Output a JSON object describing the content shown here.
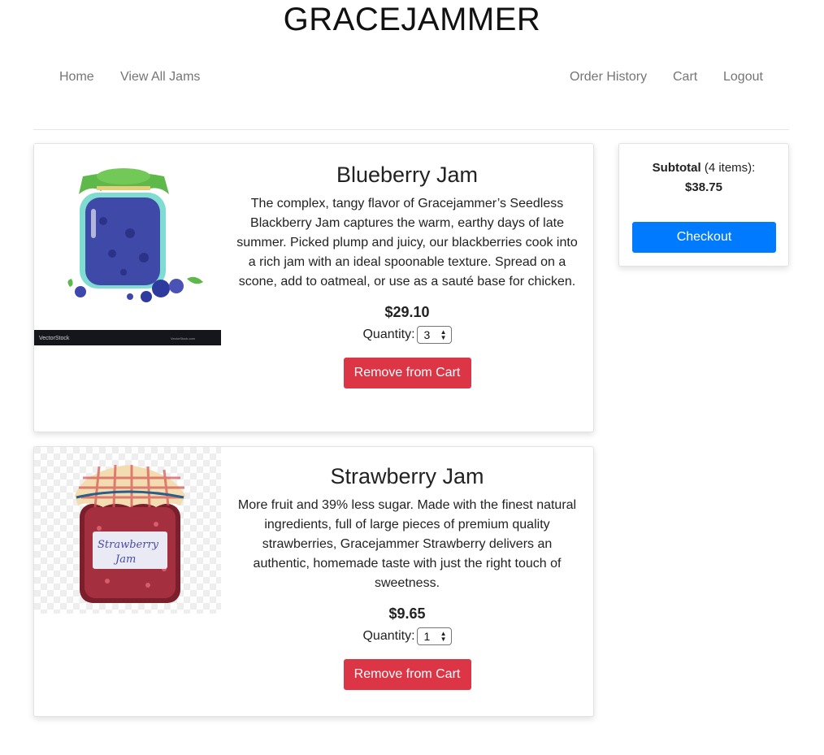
{
  "site": {
    "title": "GRACEJAMMER"
  },
  "nav": {
    "home": "Home",
    "view_all": "View All Jams",
    "order_history": "Order History",
    "cart": "Cart",
    "logout": "Logout"
  },
  "cart_items": [
    {
      "name": "Blueberry Jam",
      "description": "The complex, tangy flavor of Gracejammer’s Seedless Blackberry Jam captures the warm, earthy days of late summer. Picked plump and juicy, our blackberries cook into a rich jam with an ideal spoonable texture. Spread on a scone, add to oatmeal, or use as a sauté base for chicken.",
      "price": "$29.10",
      "quantity_label": "Quantity:",
      "quantity": "3",
      "remove_label": "Remove from Cart",
      "image_watermark": "VectorStock"
    },
    {
      "name": "Strawberry Jam",
      "description": "More fruit and 39% less sugar. Made with the finest natural ingredients, full of large pieces of premium quality strawberries, Gracejammer Strawberry delivers an authentic, homemade taste with just the right touch of sweetness.",
      "price": "$9.65",
      "quantity_label": "Quantity:",
      "quantity": "1",
      "remove_label": "Remove from Cart",
      "image_label": "Strawberry Jam"
    }
  ],
  "summary": {
    "subtotal_label": "Subtotal",
    "items_count": "(4 items):",
    "total": "$38.75",
    "checkout_label": "Checkout"
  },
  "colors": {
    "remove_button": "#dc3545",
    "checkout_button": "#007bff",
    "nav_text": "#757575"
  }
}
